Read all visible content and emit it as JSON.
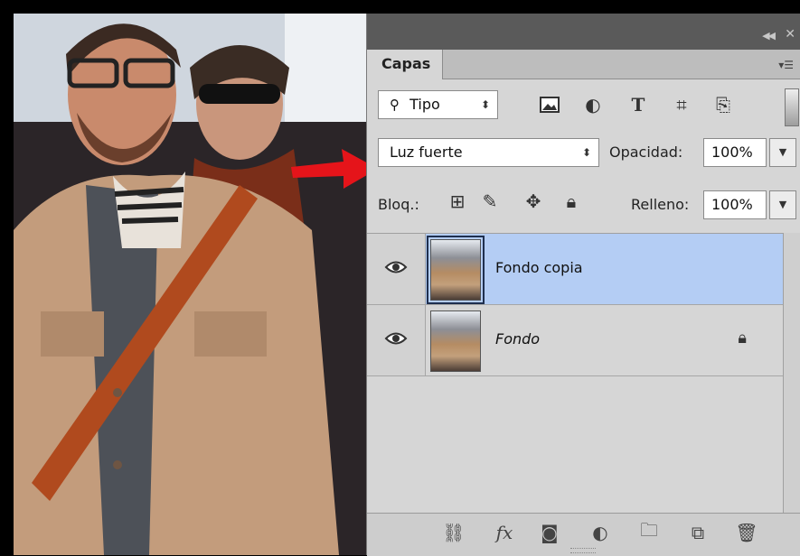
{
  "panel": {
    "tab_label": "Capas",
    "filter": {
      "value": "Tipo",
      "icon": "search-icon"
    },
    "filter_icons": [
      "image-icon",
      "adjustment-icon",
      "type-icon",
      "shape-icon",
      "smart-object-icon"
    ],
    "blend_mode": "Luz fuerte",
    "opacity_label": "Opacidad:",
    "opacity_value": "100%",
    "lock_label": "Bloq.:",
    "lock_icons": [
      "lock-transparency-icon",
      "lock-paint-icon",
      "lock-position-icon",
      "lock-all-icon"
    ],
    "fill_label": "Relleno:",
    "fill_value": "100%",
    "layers": [
      {
        "name": "Fondo copia",
        "visible": true,
        "selected": true,
        "locked": false
      },
      {
        "name": "Fondo",
        "visible": true,
        "selected": false,
        "locked": true
      }
    ],
    "footer_icons": [
      "link-icon",
      "fx-icon",
      "mask-icon",
      "adjustment-layer-icon",
      "folder-icon",
      "new-layer-icon",
      "trash-icon"
    ]
  },
  "colors": {
    "selected_layer": "#b4cdf4",
    "annotation_arrow": "#e5141a",
    "panel_bg": "#d6d6d6"
  }
}
